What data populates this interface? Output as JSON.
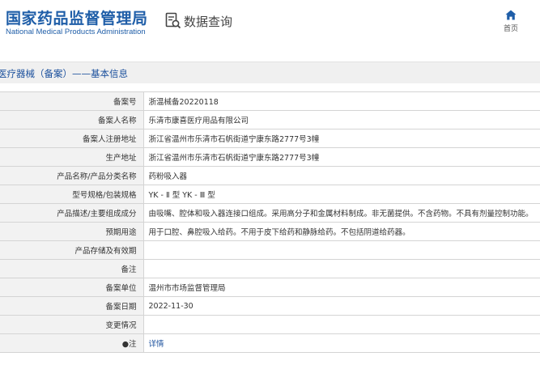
{
  "header": {
    "logo_cn": "国家药品监督管理局",
    "logo_en": "National Medical Products Administration",
    "data_query_label": "数据查询",
    "data_query_icon": "document-search-icon",
    "home_label": "首页",
    "home_icon": "home-icon"
  },
  "breadcrumb": {
    "text": "医疗器械（备案）——基本信息"
  },
  "info_rows": [
    {
      "label": "备案号",
      "value": "浙温械备20220118"
    },
    {
      "label": "备案人名称",
      "value": "乐清市康喜医疗用品有限公司"
    },
    {
      "label": "备案人注册地址",
      "value": "浙江省温州市乐清市石帆街道宁康东路2777号3幢"
    },
    {
      "label": "生产地址",
      "value": "浙江省温州市乐清市石帆街道宁康东路2777号3幢"
    },
    {
      "label": "产品名称/产品分类名称",
      "value": "药粉吸入器"
    },
    {
      "label": "型号规格/包装规格",
      "value": "YK - Ⅱ 型 YK - Ⅲ 型"
    },
    {
      "label": "产品描述/主要组成成分",
      "value": "由吸嘴、腔体和吸入器连接口组成。采用高分子和金属材料制成。非无菌提供。不含药物。不具有剂量控制功能。"
    },
    {
      "label": "预期用途",
      "value": "用于口腔、鼻腔吸入给药。不用于皮下给药和静脉给药。不包括阴道给药器。"
    },
    {
      "label": "产品存储及有效期",
      "value": ""
    },
    {
      "label": "备注",
      "value": ""
    },
    {
      "label": "备案单位",
      "value": "温州市市场监督管理局"
    },
    {
      "label": "备案日期",
      "value": "2022-11-30"
    },
    {
      "label": "变更情况",
      "value": ""
    },
    {
      "label": "●注",
      "value": "详情"
    }
  ],
  "colors": {
    "brand_blue": "#1f5ea8",
    "link_blue": "#1a4f9c",
    "label_bg": "#f2f2f2",
    "crumb_bg": "#f0f0f0"
  }
}
